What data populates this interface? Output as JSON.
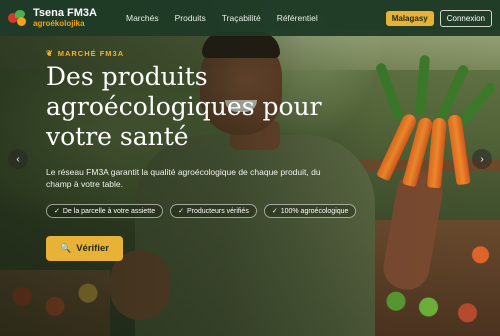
{
  "brand": {
    "title": "Tsena FM3A",
    "subtitle": "agroékolojika"
  },
  "nav": {
    "links": [
      "Marchés",
      "Produits",
      "Traçabilité",
      "Référentiel"
    ],
    "language": "Malagasy",
    "login": "Connexion"
  },
  "hero": {
    "eyebrow": "MARCHÉ FM3A",
    "eyebrow_icon": "leaf-icon",
    "headline": "Des produits agroécologiques pour votre santé",
    "description": "Le réseau FM3A garantit la qualité agroécologique de chaque produit, du champ à votre table.",
    "chips": [
      {
        "icon": "check-icon",
        "glyph": "✓",
        "label": "De la parcelle à votre assiette"
      },
      {
        "icon": "check-icon",
        "glyph": "✓",
        "label": "Producteurs vérifiés"
      },
      {
        "icon": "check-icon",
        "glyph": "✓",
        "label": "100% agroécologique"
      }
    ],
    "cta": {
      "label": "Vérifier",
      "icon": "search-icon"
    },
    "arrows": {
      "prev": "‹",
      "next": "›"
    }
  },
  "colors": {
    "navbar": "#1e3a26",
    "accent": "#e8b236",
    "eyebrow": "#f2b02c",
    "headline": "#ffffff"
  }
}
